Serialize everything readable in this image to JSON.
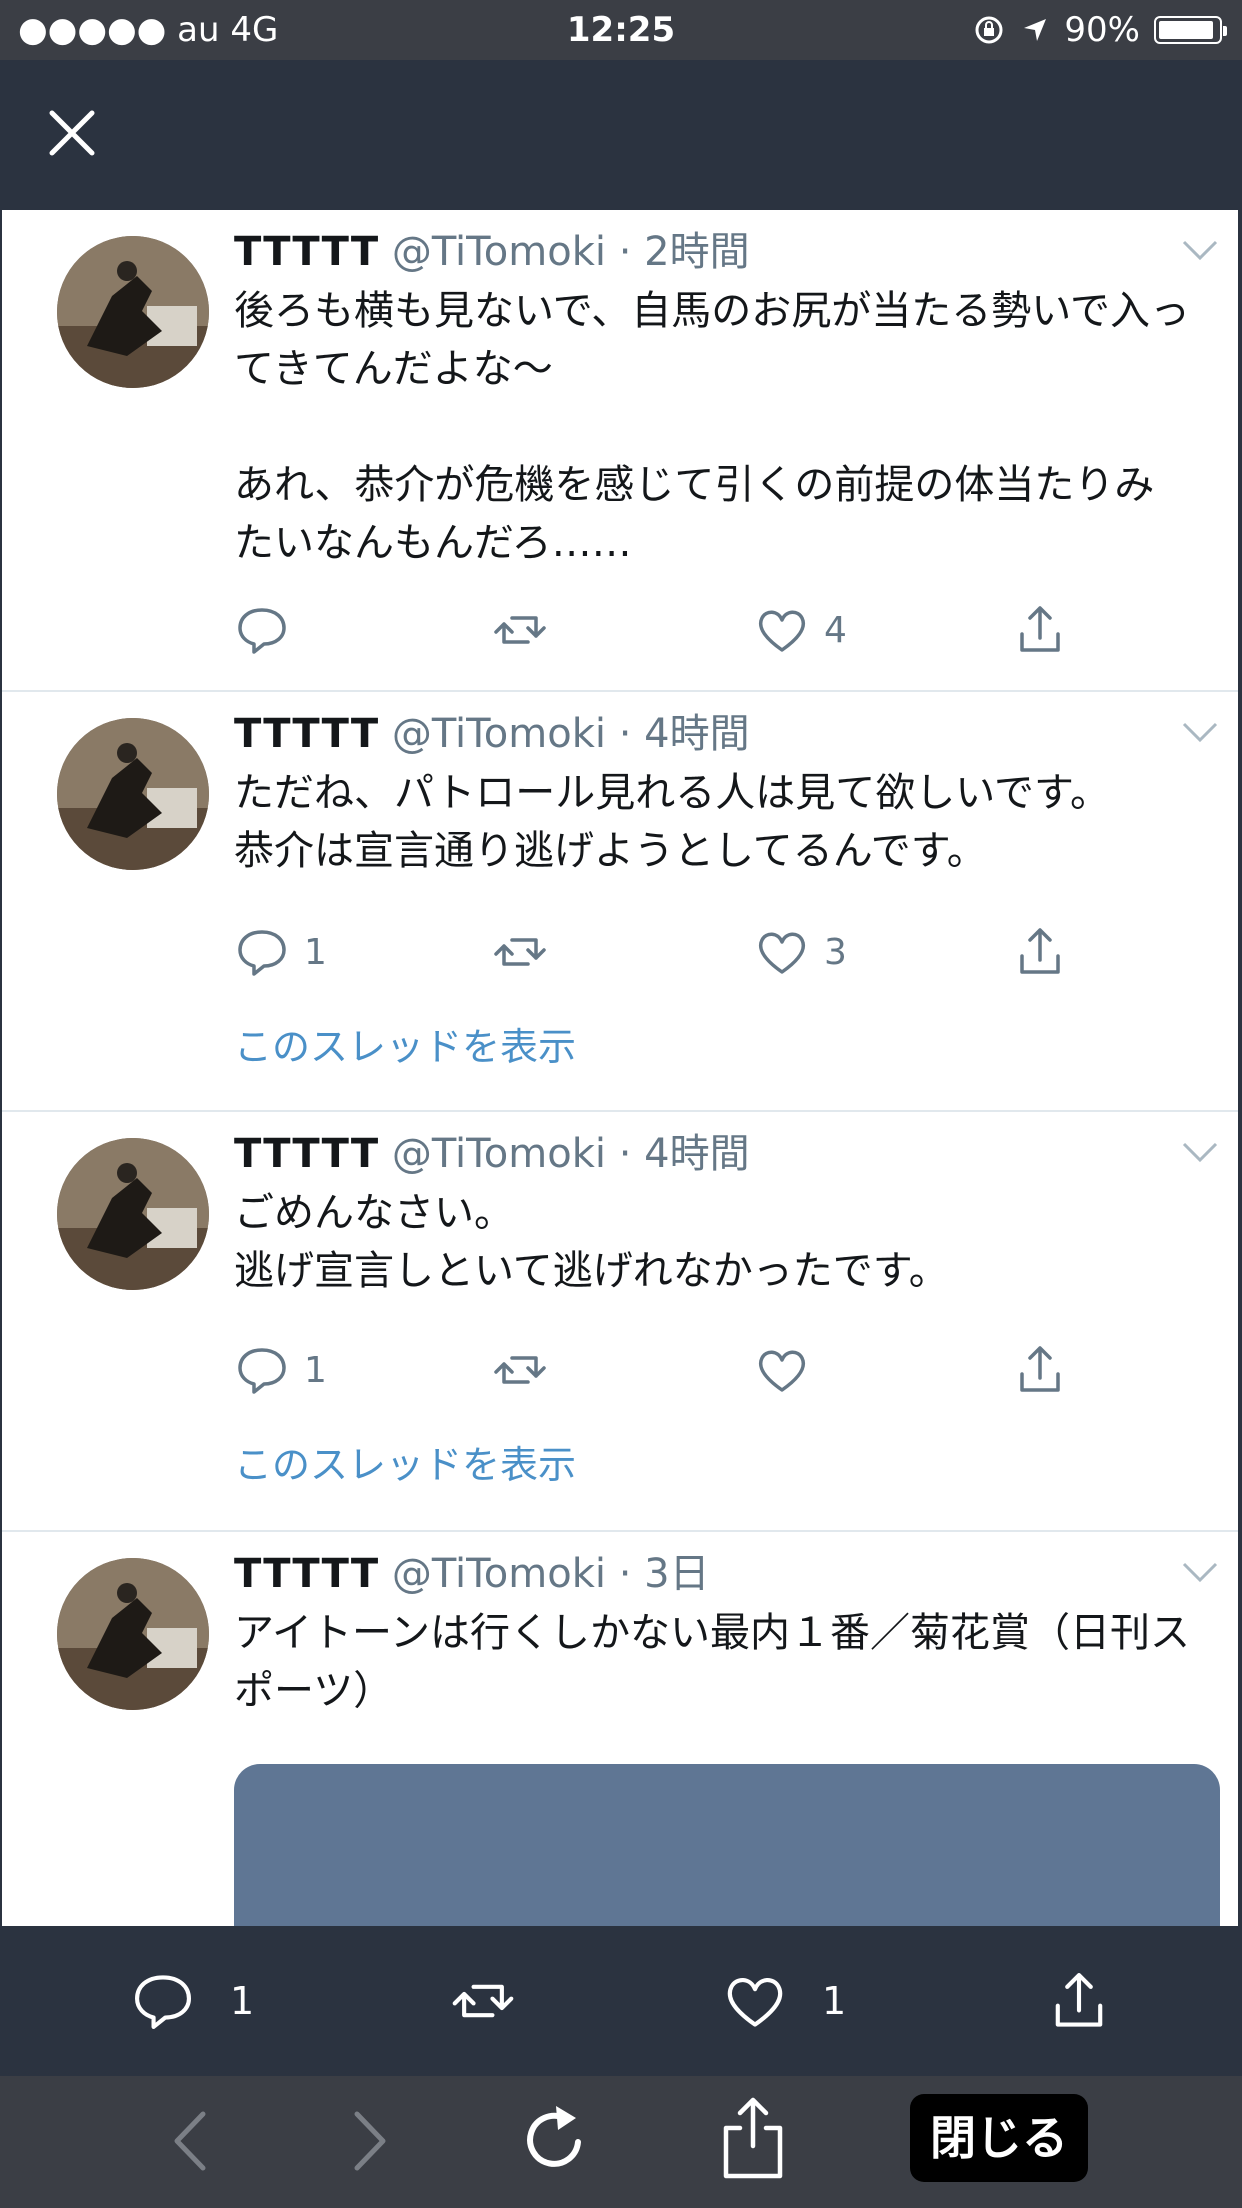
{
  "status_bar": {
    "carrier": "●●●●● au  4G",
    "time": "12:25",
    "battery": "90%"
  },
  "icons": {
    "close": "close-icon",
    "reply": "reply-icon",
    "retweet": "retweet-icon",
    "like": "heart-icon",
    "share": "share-icon",
    "caret": "chevron-down-icon"
  },
  "tweets": [
    {
      "name": "TTTTT",
      "handle": "@TiTomoki",
      "time": "· 2時間",
      "text": "後ろも横も見ないで、自馬のお尻が当たる勢いで入ってきてんだよな〜\n\nあれ、恭介が危機を感じて引くの前提の体当たりみたいなんもんだろ……",
      "replies": "",
      "retweets": "",
      "likes": "4"
    },
    {
      "name": "TTTTT",
      "handle": "@TiTomoki",
      "time": "· 4時間",
      "text": "ただね、パトロール見れる人は見て欲しいです。\n恭介は宣言通り逃げようとしてるんです。",
      "replies": "1",
      "retweets": "",
      "likes": "3",
      "thread_link": "このスレッドを表示"
    },
    {
      "name": "TTTTT",
      "handle": "@TiTomoki",
      "time": "· 4時間",
      "text": "ごめんなさい。\n逃げ宣言しといて逃げれなかったです。",
      "replies": "1",
      "retweets": "",
      "likes": "",
      "thread_link": "このスレッドを表示"
    },
    {
      "name": "TTTTT",
      "handle": "@TiTomoki",
      "time": "· 3日",
      "text": "アイトーンは行くしかない最内１番／菊花賞（日刊スポーツ）"
    }
  ],
  "tweet_bar": {
    "replies": "1",
    "likes": "1"
  },
  "browser_bar": {
    "close_label": "閉じる"
  },
  "colors": {
    "header_bg": "#2b3340",
    "link": "#4a90c8",
    "secondary_text": "#657786"
  }
}
